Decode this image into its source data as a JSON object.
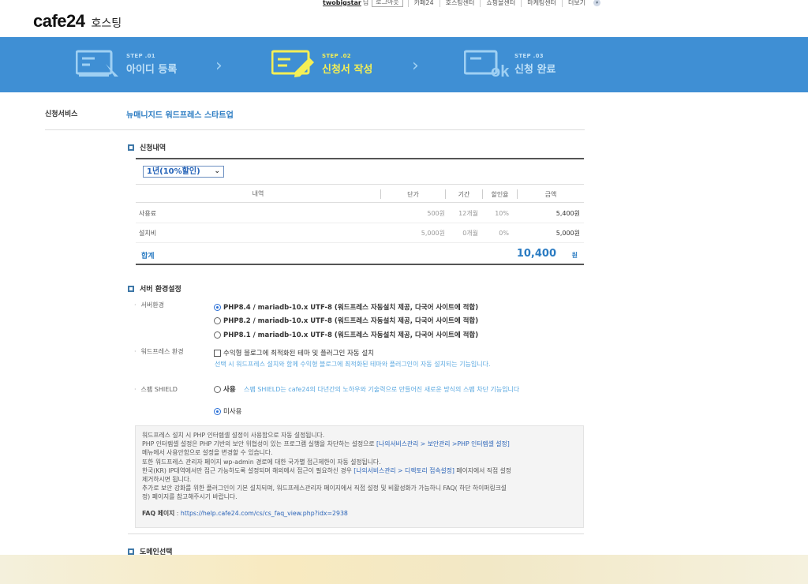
{
  "topnav": {
    "username": "twobigstar",
    "honorific": "님",
    "logout": "로그아웃",
    "links": [
      "카페24",
      "호스팅센터",
      "쇼핑몰센터",
      "마케팅센터",
      "더보기"
    ]
  },
  "logo": {
    "brand": "cafe24",
    "sub": "호스팅"
  },
  "steps": [
    {
      "num": "STEP .01",
      "label": "아이디 등록",
      "icon": "id-register-icon",
      "state": "inactive"
    },
    {
      "num": "STEP .02",
      "label": "신청서 작성",
      "icon": "form-write-icon",
      "state": "active"
    },
    {
      "num": "STEP .03",
      "label": "신청 완료",
      "icon": "ok-complete-icon",
      "state": "inactive"
    }
  ],
  "service": {
    "label": "신청서비스",
    "value": "뉴매니지드 워드프레스 스타트업"
  },
  "order": {
    "title": "신청내역",
    "period": "1년(10%할인)",
    "headers": [
      "내역",
      "단가",
      "기간",
      "할인율",
      "금액"
    ],
    "rows": [
      {
        "item": "사용료",
        "price": "500원",
        "period": "12개월",
        "discount": "10%",
        "amount": "5,400원"
      },
      {
        "item": "설치비",
        "price": "5,000원",
        "period": "0개월",
        "discount": "0%",
        "amount": "5,000원"
      }
    ],
    "total_label": "합계",
    "total_value": "10,400",
    "total_unit": "원"
  },
  "server": {
    "title": "서버 환경설정",
    "env_label": "서버환경",
    "php_options": [
      {
        "label": "PHP8.4 / mariadb-10.x UTF-8 (워드프레스 자동설치 제공, 다국어 사이트에 적합)",
        "selected": true
      },
      {
        "label": "PHP8.2 / mariadb-10.x UTF-8 (워드프레스 자동설치 제공, 다국어 사이트에 적합)",
        "selected": false
      },
      {
        "label": "PHP8.1 / mariadb-10.x UTF-8 (워드프레스 자동설치 제공, 다국어 사이트에 적합)",
        "selected": false
      }
    ],
    "wp_label": "워드프레스 환경",
    "wp_checkbox": "수익형 블로그에 최적화된 테마 및 플러그인 자동 설치",
    "wp_desc": "선택 시 워드프레스 설치와 함께 수익형 블로그에 최적화된 테마와 플러그인이 자동 설치되는 기능입니다.",
    "spam_label": "스팸 SHIELD",
    "spam_use": "사용",
    "spam_desc": "스팸 SHIELD는 cafe24의 다년간의 노하우와 기술력으로 만들어진 새로운 방식의 스팸 차단 기능입니다",
    "spam_nouse": "미사용"
  },
  "info": {
    "line1": "워드프레스 설치 시 PHP 인터렙셀 설정이 사용함으로 자동 설정됩니다.",
    "line2a": "PHP 인터렙셀 설정은 PHP 기반의 보안 위협성이 있는 프로그램 실행을 차단하는 설정으로 ",
    "line2b": "[나의서비스관리 > 보안관리 >PHP 인터렙셀 설정]",
    "line3": "메뉴에서 사용안함으로 설정을 변경할 수 있습니다.",
    "line4": "또한 워드프레스 관리자 페이지 wp-admin 경로에 대한 국가별 접근제한이 자동 설정됩니다.",
    "line5a": "한국(KR) IP대역에서만 접근 가능하도록 설정되며 해외에서 접근이 필요하신 경우 ",
    "line5b": "[나의서비스관리 > 디렉토리 접속설정]",
    "line5c": " 페이지에서 직접 설정",
    "line6": "제거하시면 됩니다.",
    "line7": "추가로 보안 강화를 위한 플러그인이 기본 설치되며, 워드프레스관리자 페이지에서 직접 설정 및 비활성화가 가능하니 FAQ( 하단 하이퍼링크설",
    "line8": "정) 페이지를 참고해주시기 바랍니다.",
    "faq_label": "FAQ 페이지",
    "faq_url": "https://help.cafe24.com/cs/cs_faq_view.php?idx=2938"
  },
  "next_section": {
    "title": "도메인선택"
  },
  "colors": {
    "banner": "#3f8fd4",
    "active_step": "#f4ef55",
    "accent_blue": "#2a7bc2"
  }
}
